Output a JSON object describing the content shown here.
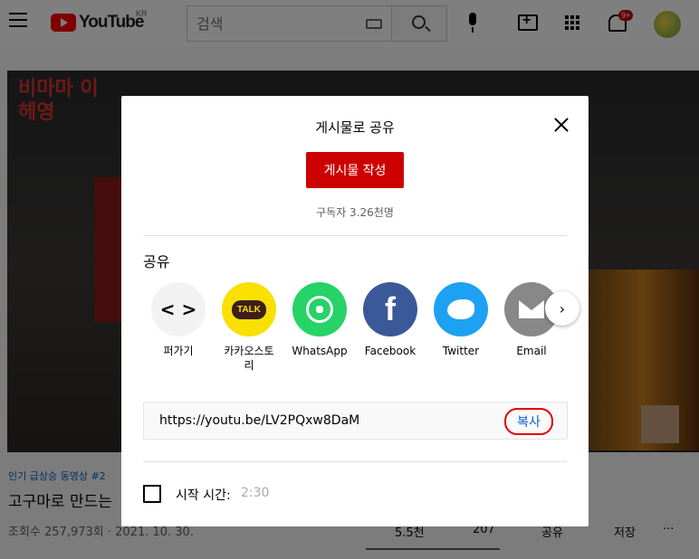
{
  "header": {
    "logo_text": "YouTube",
    "country_code": "KR",
    "search_placeholder": "검색",
    "notification_count": "9+"
  },
  "video": {
    "overlay_text": "비마마 이헤영",
    "tag": "인기 급상승 동영상 #2",
    "title": "고구마로 만드는",
    "views": "조회수 257,973회 · 2021. 10. 30.",
    "actions": {
      "like": "5.5천",
      "dislike": "207",
      "share": "공유",
      "save": "저장",
      "more": "···"
    }
  },
  "dialog": {
    "title": "게시물로 공유",
    "post_button": "게시물 작성",
    "subscribers": "구독자 3.26천명",
    "share_label": "공유",
    "targets": [
      {
        "label": "퍼가기",
        "icon": "embed-icon",
        "glyph": "< >"
      },
      {
        "label": "카카오스토리",
        "icon": "kakaotalk-icon",
        "glyph": "TALK"
      },
      {
        "label": "WhatsApp",
        "icon": "whatsapp-icon"
      },
      {
        "label": "Facebook",
        "icon": "facebook-icon",
        "glyph": "f"
      },
      {
        "label": "Twitter",
        "icon": "twitter-icon"
      },
      {
        "label": "Email",
        "icon": "email-icon"
      }
    ],
    "url": "https://youtu.be/LV2PQxw8DaM",
    "copy_label": "복사",
    "start_label": "시작 시간:",
    "start_value": "2:30"
  },
  "colors": {
    "brand_red": "#cc0000",
    "link_blue": "#065fd4",
    "annotation_red": "#e00000"
  }
}
